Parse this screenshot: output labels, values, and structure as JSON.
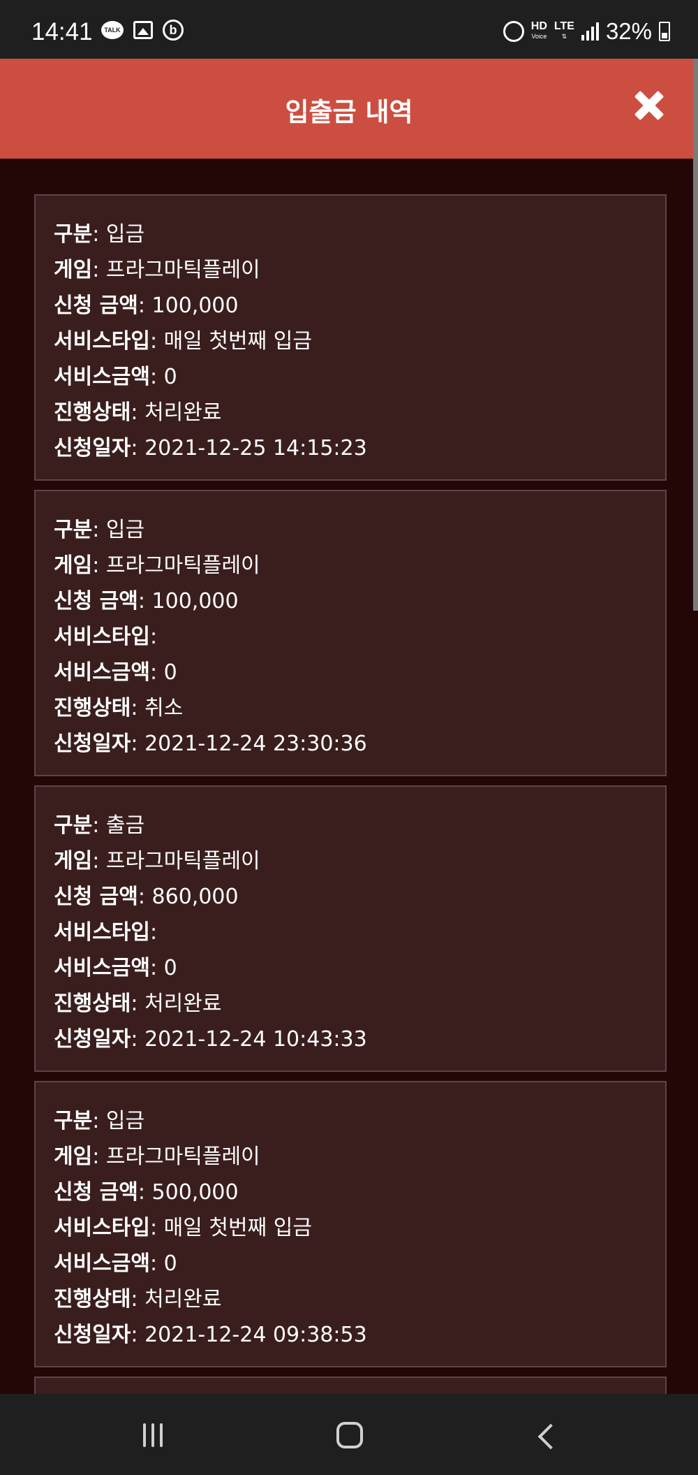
{
  "status_bar": {
    "time": "14:41",
    "talk_label": "TALK",
    "b_label": "b",
    "hd_label": "HD",
    "voice_label": "Voice",
    "lte_label": "LTE",
    "battery": "32%",
    "left_icons": [
      "kakaotalk-icon",
      "gallery-icon",
      "b-app-icon"
    ],
    "right_icons": [
      "alarm-icon",
      "hd-voice-icon",
      "lte-icon",
      "signal-icon",
      "battery-charging-icon"
    ]
  },
  "header": {
    "title": "입출금 내역",
    "close_icon": "close-icon",
    "background": "#cc4e40"
  },
  "labels": {
    "type": "구분",
    "game": "게임",
    "amount": "신청 금액",
    "service_type": "서비스타입",
    "service_amount": "서비스금액",
    "status": "진행상태",
    "date": "신청일자"
  },
  "records": [
    {
      "type": "입금",
      "game": "프라그마틱플레이",
      "amount": "100,000",
      "service_type": "매일 첫번째 입금",
      "service_amount": "0",
      "status": "처리완료",
      "date": "2021-12-25 14:15:23"
    },
    {
      "type": "입금",
      "game": "프라그마틱플레이",
      "amount": "100,000",
      "service_type": "",
      "service_amount": "0",
      "status": "취소",
      "date": "2021-12-24 23:30:36"
    },
    {
      "type": "출금",
      "game": "프라그마틱플레이",
      "amount": "860,000",
      "service_type": "",
      "service_amount": "0",
      "status": "처리완료",
      "date": "2021-12-24 10:43:33"
    },
    {
      "type": "입금",
      "game": "프라그마틱플레이",
      "amount": "500,000",
      "service_type": "매일 첫번째 입금",
      "service_amount": "0",
      "status": "처리완료",
      "date": "2021-12-24 09:38:53"
    }
  ],
  "nav_bar": {
    "icons": [
      "recent-apps-icon",
      "home-icon",
      "back-icon"
    ]
  },
  "colors": {
    "page_background": "#230606",
    "card_background": "#3a1e1e",
    "card_border": "#5c4545"
  }
}
